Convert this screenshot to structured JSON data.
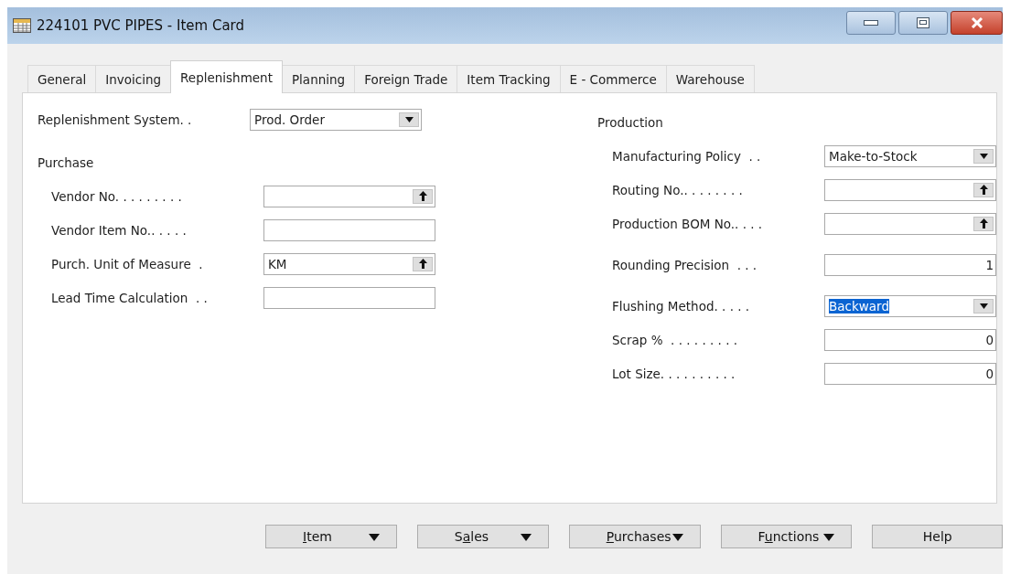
{
  "window": {
    "title": "224101 PVC PIPES - Item Card"
  },
  "tabs": [
    {
      "label": "General",
      "selected": false
    },
    {
      "label": "Invoicing",
      "selected": false
    },
    {
      "label": "Replenishment",
      "selected": true
    },
    {
      "label": "Planning",
      "selected": false
    },
    {
      "label": "Foreign Trade",
      "selected": false
    },
    {
      "label": "Item Tracking",
      "selected": false
    },
    {
      "label": "E - Commerce",
      "selected": false
    },
    {
      "label": "Warehouse",
      "selected": false
    }
  ],
  "left_column": [
    {
      "kind": "dropdown",
      "label": "Replenishment System. .",
      "value": "Prod. Order"
    },
    {
      "kind": "heading",
      "label": "Purchase"
    },
    {
      "kind": "lookup",
      "label": "Vendor No. . . . . . . . ."
    },
    {
      "kind": "text",
      "label": "Vendor Item No.. . . . ."
    },
    {
      "kind": "lookup",
      "label": "Purch. Unit of Measure  .",
      "value": "KM"
    },
    {
      "kind": "text",
      "label": "Lead Time Calculation  . ."
    }
  ],
  "right_column": [
    {
      "kind": "heading",
      "label": "Production"
    },
    {
      "kind": "dropdown",
      "label": "Manufacturing Policy  . .",
      "value": "Make-to-Stock"
    },
    {
      "kind": "lookup",
      "label": "Routing No.. . . . . . . ."
    },
    {
      "kind": "lookup",
      "label": "Production BOM No.. . . ."
    },
    {
      "kind": "number",
      "label": "Rounding Precision  . . .",
      "value": "1"
    },
    {
      "kind": "dropdown",
      "label": "Flushing Method. . . . .",
      "value": "Backward",
      "text_selected": true
    },
    {
      "kind": "number",
      "label": "Scrap %  . . . . . . . . .",
      "value": "0"
    },
    {
      "kind": "number",
      "label": "Lot Size. . . . . . . . . .",
      "value": "0"
    }
  ],
  "buttons": [
    {
      "label": {
        "access_key": "I",
        "after": "tem"
      },
      "has_menu": true
    },
    {
      "label": {
        "before": "S",
        "access_key": "a",
        "after": "les"
      },
      "has_menu": true
    },
    {
      "label": {
        "access_key": "P",
        "after": "urchases"
      },
      "has_menu": true
    },
    {
      "label": {
        "before": "F",
        "access_key": "u",
        "after": "nctions"
      },
      "has_menu": true
    },
    {
      "label": {
        "before": "Help"
      },
      "has_menu": false
    }
  ]
}
